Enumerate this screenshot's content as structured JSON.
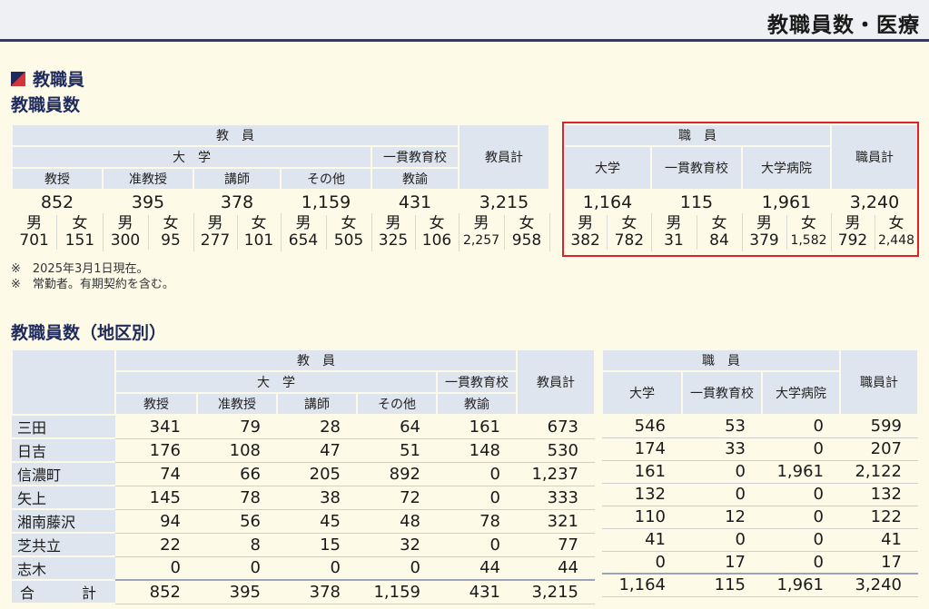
{
  "header": {
    "title": "教職員数・医療"
  },
  "section": {
    "title": "教職員"
  },
  "table1": {
    "title": "教職員数",
    "h_kyoin": "教　員",
    "h_daigaku": "大　学",
    "h_ikkan": "一貫教育校",
    "h_kyoin_kei": "教員計",
    "cols": [
      "教授",
      "准教授",
      "講師",
      "その他"
    ],
    "h_kyoyu": "教諭",
    "totals": [
      "852",
      "395",
      "378",
      "1,159",
      "431",
      "3,215"
    ],
    "male": "男",
    "female": "女",
    "gender": [
      [
        "701",
        "151"
      ],
      [
        "300",
        "95"
      ],
      [
        "277",
        "101"
      ],
      [
        "654",
        "505"
      ],
      [
        "325",
        "106"
      ],
      [
        "2,257",
        "958"
      ]
    ],
    "h_shokuin": "職　員",
    "h_s_daigaku": "大学",
    "h_s_ikkan": "一貫教育校",
    "h_s_byoin": "大学病院",
    "h_shokuin_kei": "職員計",
    "s_totals": [
      "1,164",
      "115",
      "1,961",
      "3,240"
    ],
    "s_gender": [
      [
        "382",
        "782"
      ],
      [
        "31",
        "84"
      ],
      [
        "379",
        "1,582"
      ],
      [
        "792",
        "2,448"
      ]
    ]
  },
  "notes": [
    "※　2025年3月1日現在。",
    "※　常勤者。有期契約を含む。"
  ],
  "table2": {
    "title": "教職員数（地区別）",
    "rows": [
      {
        "name": "三田",
        "v": [
          "341",
          "79",
          "28",
          "64",
          "161",
          "673"
        ],
        "s": [
          "546",
          "53",
          "0",
          "599"
        ]
      },
      {
        "name": "日吉",
        "v": [
          "176",
          "108",
          "47",
          "51",
          "148",
          "530"
        ],
        "s": [
          "174",
          "33",
          "0",
          "207"
        ]
      },
      {
        "name": "信濃町",
        "v": [
          "74",
          "66",
          "205",
          "892",
          "0",
          "1,237"
        ],
        "s": [
          "161",
          "0",
          "1,961",
          "2,122"
        ]
      },
      {
        "name": "矢上",
        "v": [
          "145",
          "78",
          "38",
          "72",
          "0",
          "333"
        ],
        "s": [
          "132",
          "0",
          "0",
          "132"
        ]
      },
      {
        "name": "湘南藤沢",
        "v": [
          "94",
          "56",
          "45",
          "48",
          "78",
          "321"
        ],
        "s": [
          "110",
          "12",
          "0",
          "122"
        ]
      },
      {
        "name": "芝共立",
        "v": [
          "22",
          "8",
          "15",
          "32",
          "0",
          "77"
        ],
        "s": [
          "41",
          "0",
          "0",
          "41"
        ]
      },
      {
        "name": "志木",
        "v": [
          "0",
          "0",
          "0",
          "0",
          "44",
          "44"
        ],
        "s": [
          "0",
          "17",
          "0",
          "17"
        ]
      }
    ],
    "total": {
      "name": "合　計",
      "v": [
        "852",
        "395",
        "378",
        "1,159",
        "431",
        "3,215"
      ],
      "s": [
        "1,164",
        "115",
        "1,961",
        "3,240"
      ]
    }
  },
  "colors": {
    "accent": "#1e2a5c",
    "highlight": "#e0202a",
    "header_bg": "#dfe5ee"
  }
}
